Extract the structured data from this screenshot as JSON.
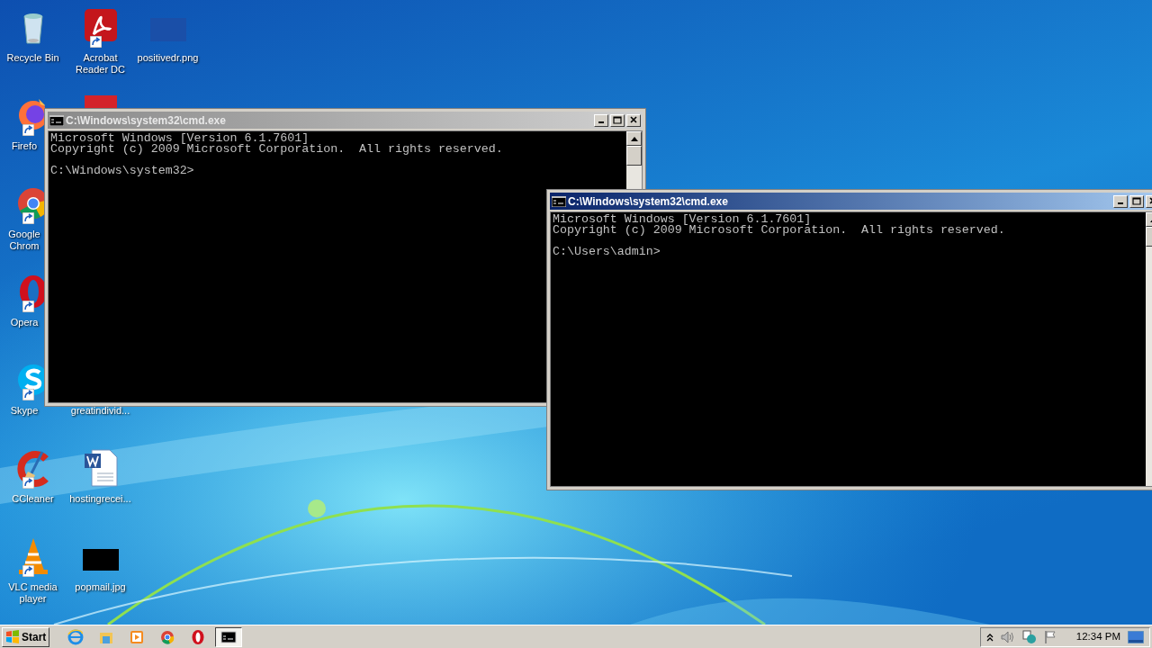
{
  "desktop_icons": [
    {
      "label": "Recycle Bin",
      "kind": "recycle",
      "shortcut": false
    },
    {
      "label": "Acrobat Reader DC",
      "kind": "acrobat",
      "shortcut": true
    },
    {
      "label": "positivedr.png",
      "kind": "image_blue",
      "shortcut": false
    },
    {
      "label": "Firefo",
      "kind": "firefox",
      "shortcut": true
    },
    {
      "kind": "five",
      "shortcut": false
    },
    {
      "label": "Google Chrom",
      "kind": "chrome",
      "shortcut": true
    },
    {
      "label": "Opera",
      "kind": "opera",
      "shortcut": true
    },
    {
      "label": "Skype",
      "kind": "skype",
      "shortcut": true
    },
    {
      "label": "greatindivid...",
      "kind": "covered",
      "shortcut": false
    },
    {
      "label": "CCleaner",
      "kind": "ccleaner",
      "shortcut": true
    },
    {
      "label": "hostingrecei...",
      "kind": "word",
      "shortcut": false
    },
    {
      "label": "VLC media player",
      "kind": "vlc",
      "shortcut": true
    },
    {
      "label": "popmail.jpg",
      "kind": "image_black",
      "shortcut": false
    }
  ],
  "windows": [
    {
      "title": "C:\\Windows\\system32\\cmd.exe",
      "active": false,
      "output": [
        "Microsoft Windows [Version 6.1.7601]",
        "Copyright (c) 2009 Microsoft Corporation.  All rights reserved."
      ],
      "prompt": "C:\\Windows\\system32>"
    },
    {
      "title": "C:\\Windows\\system32\\cmd.exe",
      "active": true,
      "output": [
        "Microsoft Windows [Version 6.1.7601]",
        "Copyright (c) 2009 Microsoft Corporation.  All rights reserved."
      ],
      "prompt": "C:\\Users\\admin>"
    }
  ],
  "taskbar": {
    "start": "Start",
    "apps": [
      {
        "kind": "ie",
        "selected": false
      },
      {
        "kind": "explorer",
        "selected": false
      },
      {
        "kind": "media",
        "selected": false
      },
      {
        "kind": "chrome",
        "selected": false
      },
      {
        "kind": "opera",
        "selected": false
      },
      {
        "kind": "cmd",
        "selected": true
      }
    ],
    "clock": "12:34 PM"
  }
}
